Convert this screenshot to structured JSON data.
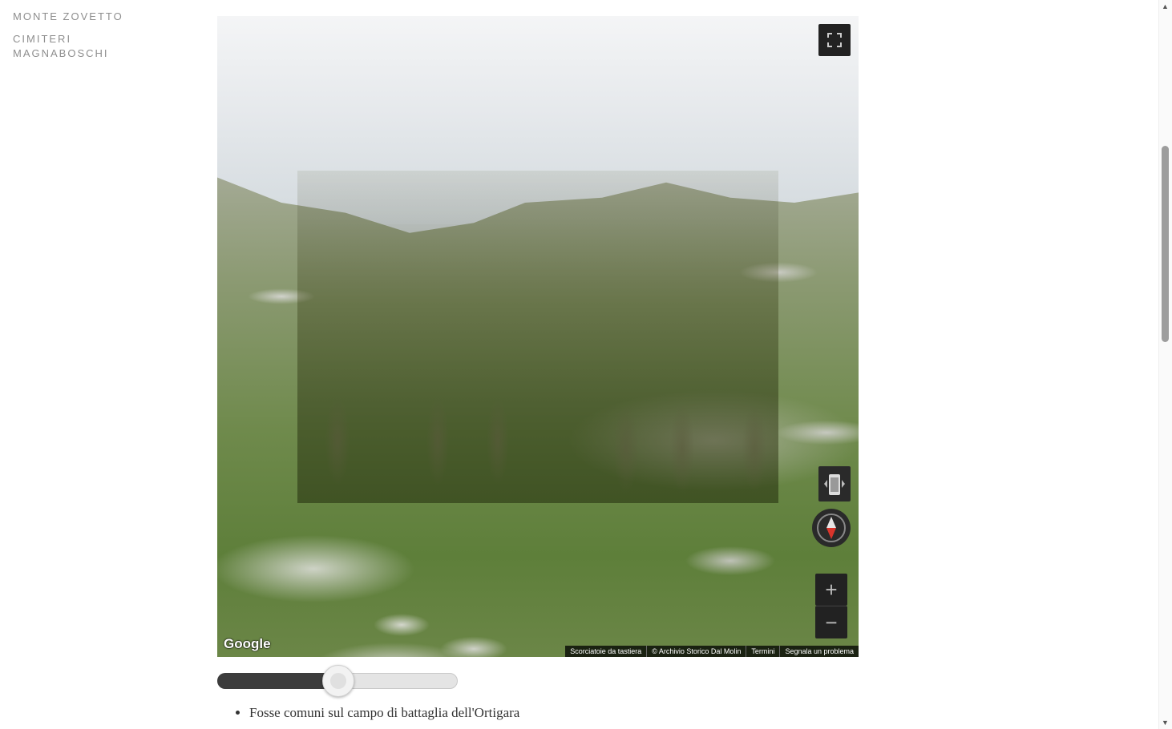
{
  "nav": {
    "items": [
      {
        "label_lines": [
          "MONTE ZOVETTO"
        ]
      },
      {
        "label_lines": [
          "CIMITERI",
          "MAGNABOSCHI"
        ]
      }
    ]
  },
  "streetview": {
    "google_logo": "Google",
    "attribution": {
      "shortcuts": "Scorciatoie da tastiera",
      "copyright": "© Archivio Storico Dal Molin",
      "terms": "Termini",
      "report": "Segnala un problema"
    },
    "zoom_in": "+",
    "zoom_out": "−",
    "icons": {
      "fullscreen": "fullscreen-icon",
      "pegman": "pegman-icon",
      "compass": "compass-icon"
    }
  },
  "slider": {
    "value_fraction": 0.5
  },
  "caption": {
    "items": [
      "Fosse comuni sul campo di battaglia dell'Ortigara"
    ]
  }
}
